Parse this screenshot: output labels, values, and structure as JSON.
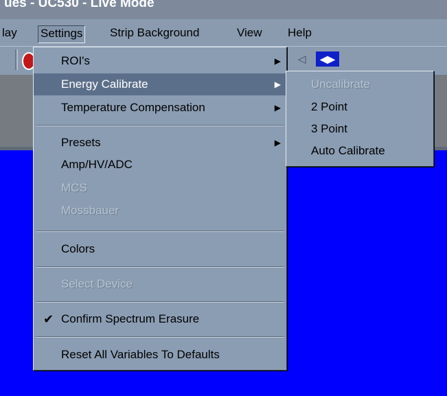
{
  "window": {
    "title": "ues - UC530 - Live Mode"
  },
  "menubar": {
    "items": [
      {
        "label": "lay"
      },
      {
        "label": "Settings"
      },
      {
        "label": "Strip Background"
      },
      {
        "label": "View"
      },
      {
        "label": "Help"
      }
    ]
  },
  "settings_menu": {
    "items": [
      {
        "label": "ROI's",
        "submenu": true
      },
      {
        "label": "Energy Calibrate",
        "submenu": true,
        "highlighted": true
      },
      {
        "label": "Temperature Compensation",
        "submenu": true
      },
      {
        "label": "Presets",
        "submenu": true
      },
      {
        "label": "Amp/HV/ADC"
      },
      {
        "label": "MCS",
        "disabled": true
      },
      {
        "label": "Mossbauer",
        "disabled": true
      },
      {
        "label": "Colors"
      },
      {
        "label": "Select Device",
        "disabled": true
      },
      {
        "label": "Confirm Spectrum Erasure",
        "checked": true
      },
      {
        "label": "Reset All Variables To Defaults"
      }
    ]
  },
  "energy_calibrate_submenu": {
    "items": [
      {
        "label": "Uncalibrate",
        "disabled": true
      },
      {
        "label": "2 Point"
      },
      {
        "label": "3 Point"
      },
      {
        "label": "Auto Calibrate"
      }
    ]
  },
  "glyphs": {
    "arrow": "▶",
    "check": "✔"
  },
  "colors": {
    "menu_bg": "#8b9db3",
    "highlight": "#5c6f8a",
    "display_bg": "#0000ff"
  }
}
